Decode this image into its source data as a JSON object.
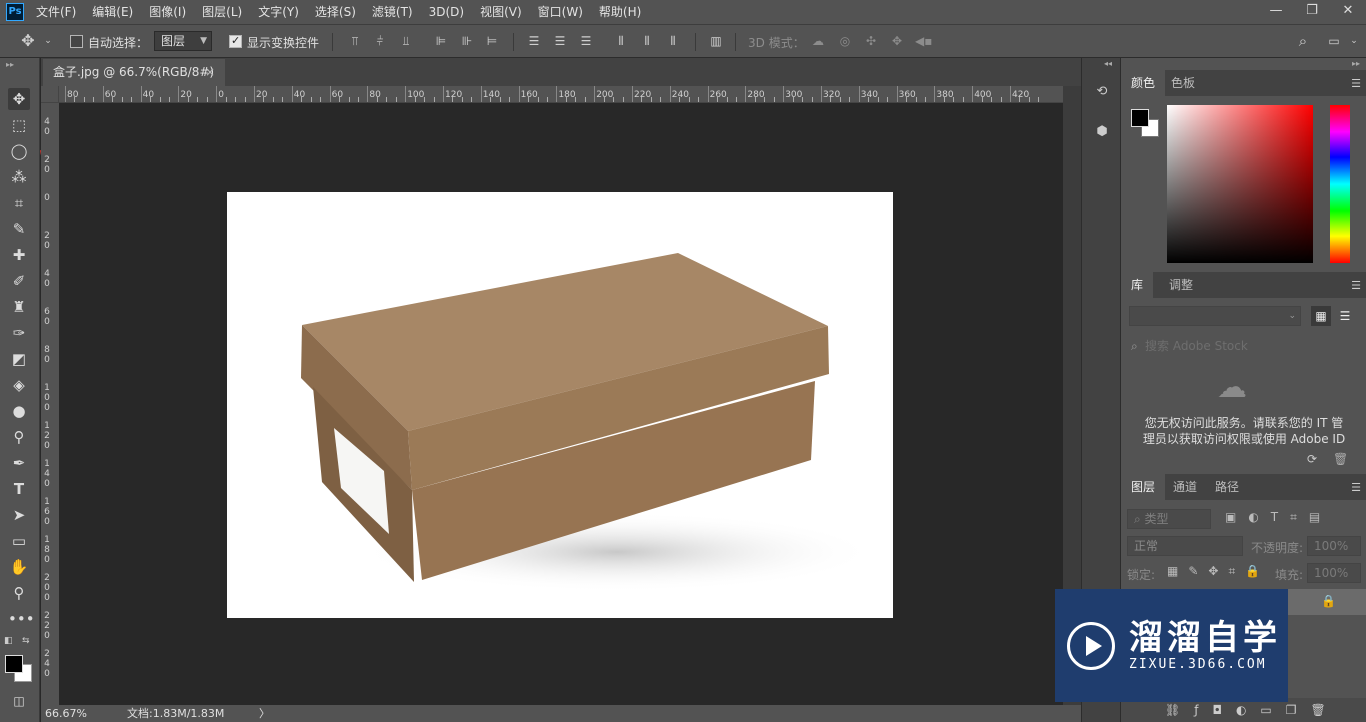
{
  "app": {
    "logo": "Ps"
  },
  "menubar": {
    "items": [
      "文件(F)",
      "编辑(E)",
      "图像(I)",
      "图层(L)",
      "文字(Y)",
      "选择(S)",
      "滤镜(T)",
      "3D(D)",
      "视图(V)",
      "窗口(W)",
      "帮助(H)"
    ],
    "window_controls": [
      "—",
      "❐",
      "✕"
    ]
  },
  "options": {
    "auto_select_label": "自动选择：",
    "auto_select_checked": false,
    "auto_select_target": "图层",
    "show_transform_label": "显示变换控件",
    "show_transform_checked": true,
    "mode_3d_label": "3D 模式："
  },
  "document": {
    "tab_title": "盒子.jpg @ 66.7%(RGB/8#)",
    "close_glyph": "×",
    "zoom": "66.67%",
    "doc_size": "文档:1.83M/1.83M",
    "status_arrow": "〉"
  },
  "rulers": {
    "h_labels": [
      "80",
      "60",
      "40",
      "20",
      "0",
      "20",
      "40",
      "60",
      "80",
      "100",
      "120",
      "140",
      "160",
      "180",
      "200",
      "220",
      "240",
      "260",
      "280",
      "300",
      "320",
      "340",
      "360",
      "380",
      "400",
      "420"
    ],
    "v_labels": [
      "4 0",
      "2 0",
      "0",
      "2 0",
      "4 0",
      "6 0",
      "8 0",
      "1 0 0",
      "1 2 0",
      "1 4 0",
      "1 6 0",
      "1 8 0",
      "2 0 0",
      "2 2 0",
      "2 4 0"
    ]
  },
  "color_panel": {
    "tabs": [
      "颜色",
      "色板"
    ],
    "fg": "#000000",
    "bg": "#ffffff"
  },
  "library_panel": {
    "tabs": [
      "库",
      "调整"
    ],
    "search_placeholder": "搜索 Adobe Stock",
    "message_line1": "您无权访问此服务。请联系您的 IT 管",
    "message_line2": "理员以获取访问权限或使用 Adobe ID"
  },
  "layers_panel": {
    "tabs": [
      "图层",
      "通道",
      "路径"
    ],
    "filter_label": "类型",
    "blend_mode": "正常",
    "opacity_label": "不透明度:",
    "opacity_value": "100%",
    "lock_label": "锁定:",
    "fill_label": "填充:",
    "fill_value": "100%"
  },
  "watermark": {
    "title": "溜溜自学",
    "subtitle": "ZIXUE.3D66.COM"
  }
}
